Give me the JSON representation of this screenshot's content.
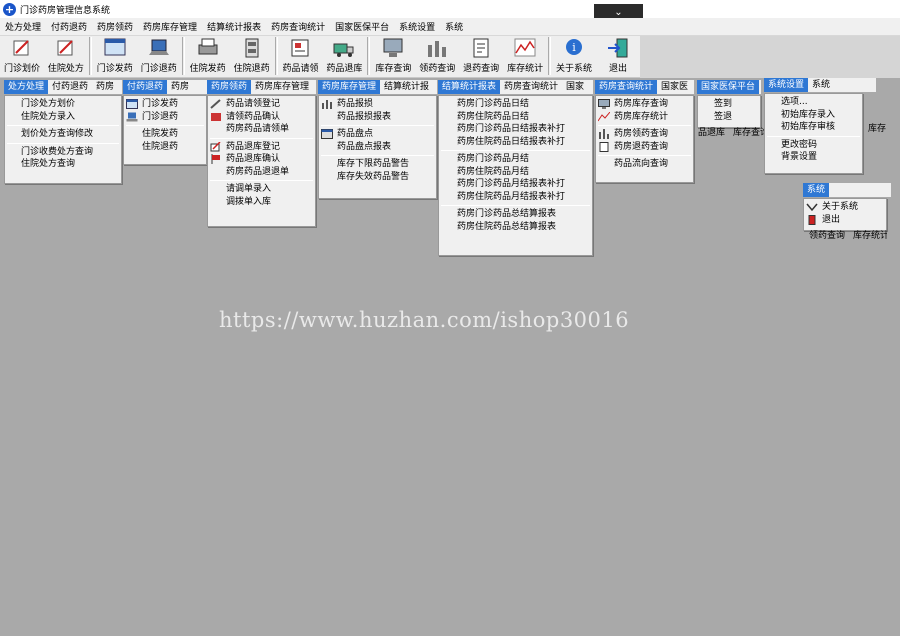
{
  "window": {
    "title": "门诊药房管理信息系统",
    "collapse_glyph": "⌄"
  },
  "menubar": [
    "处方处理",
    "付药退药",
    "药房领药",
    "药房库存管理",
    "结算统计报表",
    "药房查询统计",
    "国家医保平台",
    "系统设置",
    "系统"
  ],
  "toolbar": {
    "buttons": [
      "门诊划价",
      "住院处方",
      "门诊发药",
      "门诊退药",
      "住院发药",
      "住院退药",
      "药品请领",
      "药品退库",
      "库存查询",
      "领药查询",
      "退药查询",
      "库存统计",
      "关于系统",
      "退出"
    ]
  },
  "menus": {
    "chufang": {
      "bar": [
        "处方处理",
        "付药退药",
        "药房"
      ],
      "items": [
        "门诊处方划价",
        "住院处方录入",
        "-",
        "划价处方查询修改",
        "-",
        "门诊收费处方查询",
        "住院处方查询"
      ]
    },
    "fuyao": {
      "bar": [
        "付药退药",
        "药房"
      ],
      "items": [
        "门诊发药",
        "门诊退药",
        "-",
        "住院发药",
        "住院退药"
      ]
    },
    "lingyao": {
      "bar": [
        "药房领药",
        "药房库存管理"
      ],
      "items": [
        "药品请领登记",
        "请领药品确认",
        "药房药品请领单",
        "-",
        "药品退库登记",
        "药品退库确认",
        "药房药品退退单",
        "-",
        "请调单录入",
        "调拨单入库"
      ]
    },
    "kucun": {
      "bar": [
        "药房库存管理",
        "结算统计报"
      ],
      "items": [
        "药品报损",
        "药品报损报表",
        "-",
        "药品盘点",
        "药品盘点报表",
        "-",
        "库存下限药品警告",
        "库存失效药品警告"
      ]
    },
    "jiesuan": {
      "bar": [
        "结算统计报表",
        "药房查询统计",
        "国家"
      ],
      "items": [
        "药房门诊药品日结",
        "药房住院药品日结",
        "药房门诊药品日结报表补打",
        "药房住院药品日结报表补打",
        "-",
        "药房门诊药品月结",
        "药房住院药品月结",
        "药房门诊药品月结报表补打",
        "药房住院药品月结报表补打",
        "-",
        "药房门诊药品总结算报表",
        "药房住院药品总结算报表"
      ]
    },
    "chaxun": {
      "bar": [
        "药房查询统计",
        "国家医"
      ],
      "items": [
        "药房库存查询",
        "药房库存统计",
        "-",
        "药房领药查询",
        "药房退药查询",
        "-",
        "药品流向查询"
      ]
    },
    "yibao": {
      "bar": [
        "国家医保平台"
      ],
      "items": [
        "签到",
        "签退"
      ]
    },
    "shezhi": {
      "bar": [
        "系统设置",
        "系统"
      ],
      "items": [
        "选项...",
        "初始库存录入",
        "初始库存审核",
        "-",
        "更改密码",
        "背景设置"
      ]
    },
    "xitong": {
      "bar": [
        "系统"
      ],
      "items": [
        "关于系统",
        "退出"
      ]
    }
  },
  "behind_text": {
    "a": "品退库",
    "b": "库存查询",
    "c": "库存",
    "d": "领药查询",
    "e": "库存统计"
  },
  "watermark": "https://www.huzhan.com/ishop30016"
}
